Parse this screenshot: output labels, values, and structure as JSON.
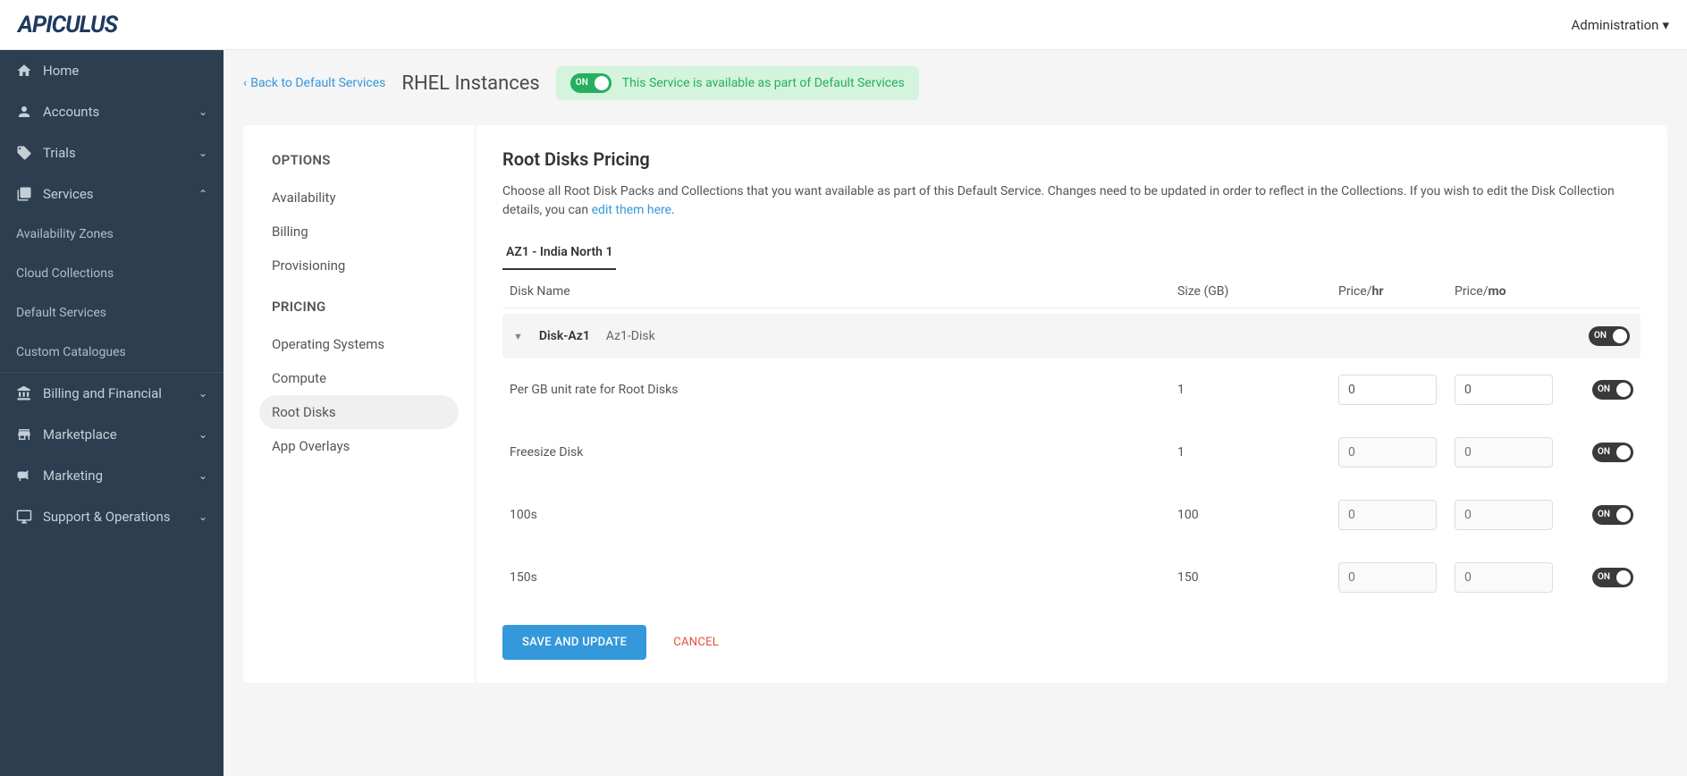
{
  "header": {
    "logo": "APICULUS",
    "admin_label": "Administration"
  },
  "sidebar": {
    "home": "Home",
    "accounts": "Accounts",
    "trials": "Trials",
    "services": "Services",
    "services_sub": [
      "Availability Zones",
      "Cloud Collections",
      "Default Services",
      "Custom Catalogues"
    ],
    "billing": "Billing and Financial",
    "marketplace": "Marketplace",
    "marketing": "Marketing",
    "support": "Support & Operations"
  },
  "topbar": {
    "back": "Back to Default Services",
    "title": "RHEL Instances",
    "toggle_label": "ON",
    "status_text": "This Service is available as part of Default Services"
  },
  "options": {
    "options_header": "OPTIONS",
    "pricing_header": "PRICING",
    "availability": "Availability",
    "billing": "Billing",
    "provisioning": "Provisioning",
    "os": "Operating Systems",
    "compute": "Compute",
    "root_disks": "Root Disks",
    "app_overlays": "App Overlays"
  },
  "detail": {
    "heading": "Root Disks Pricing",
    "desc_pre": "Choose all Root Disk Packs and Collections that you want available as part of this Default Service. Changes need to be updated in order to reflect in the Collections. If you wish to edit the Disk Collection details, you can ",
    "desc_link": "edit them here",
    "tab": "AZ1 - India North 1",
    "col_name": "Disk Name",
    "col_size": "Size (GB)",
    "col_hr_pre": "Price/",
    "col_hr_b": "hr",
    "col_mo_pre": "Price/",
    "col_mo_b": "mo",
    "group_name": "Disk-Az1",
    "group_desc": "Az1-Disk",
    "rows": [
      {
        "name": "Per GB unit rate for Root Disks",
        "size": "1",
        "hr": "0",
        "mo": "0",
        "enabled": true,
        "input_enabled": true
      },
      {
        "name": "Freesize Disk",
        "size": "1",
        "hr": "0",
        "mo": "0",
        "enabled": true,
        "input_enabled": false
      },
      {
        "name": "100s",
        "size": "100",
        "hr": "0",
        "mo": "0",
        "enabled": true,
        "input_enabled": false
      },
      {
        "name": "150s",
        "size": "150",
        "hr": "0",
        "mo": "0",
        "enabled": true,
        "input_enabled": false
      }
    ],
    "save": "SAVE AND UPDATE",
    "cancel": "CANCEL",
    "on_label": "ON"
  }
}
